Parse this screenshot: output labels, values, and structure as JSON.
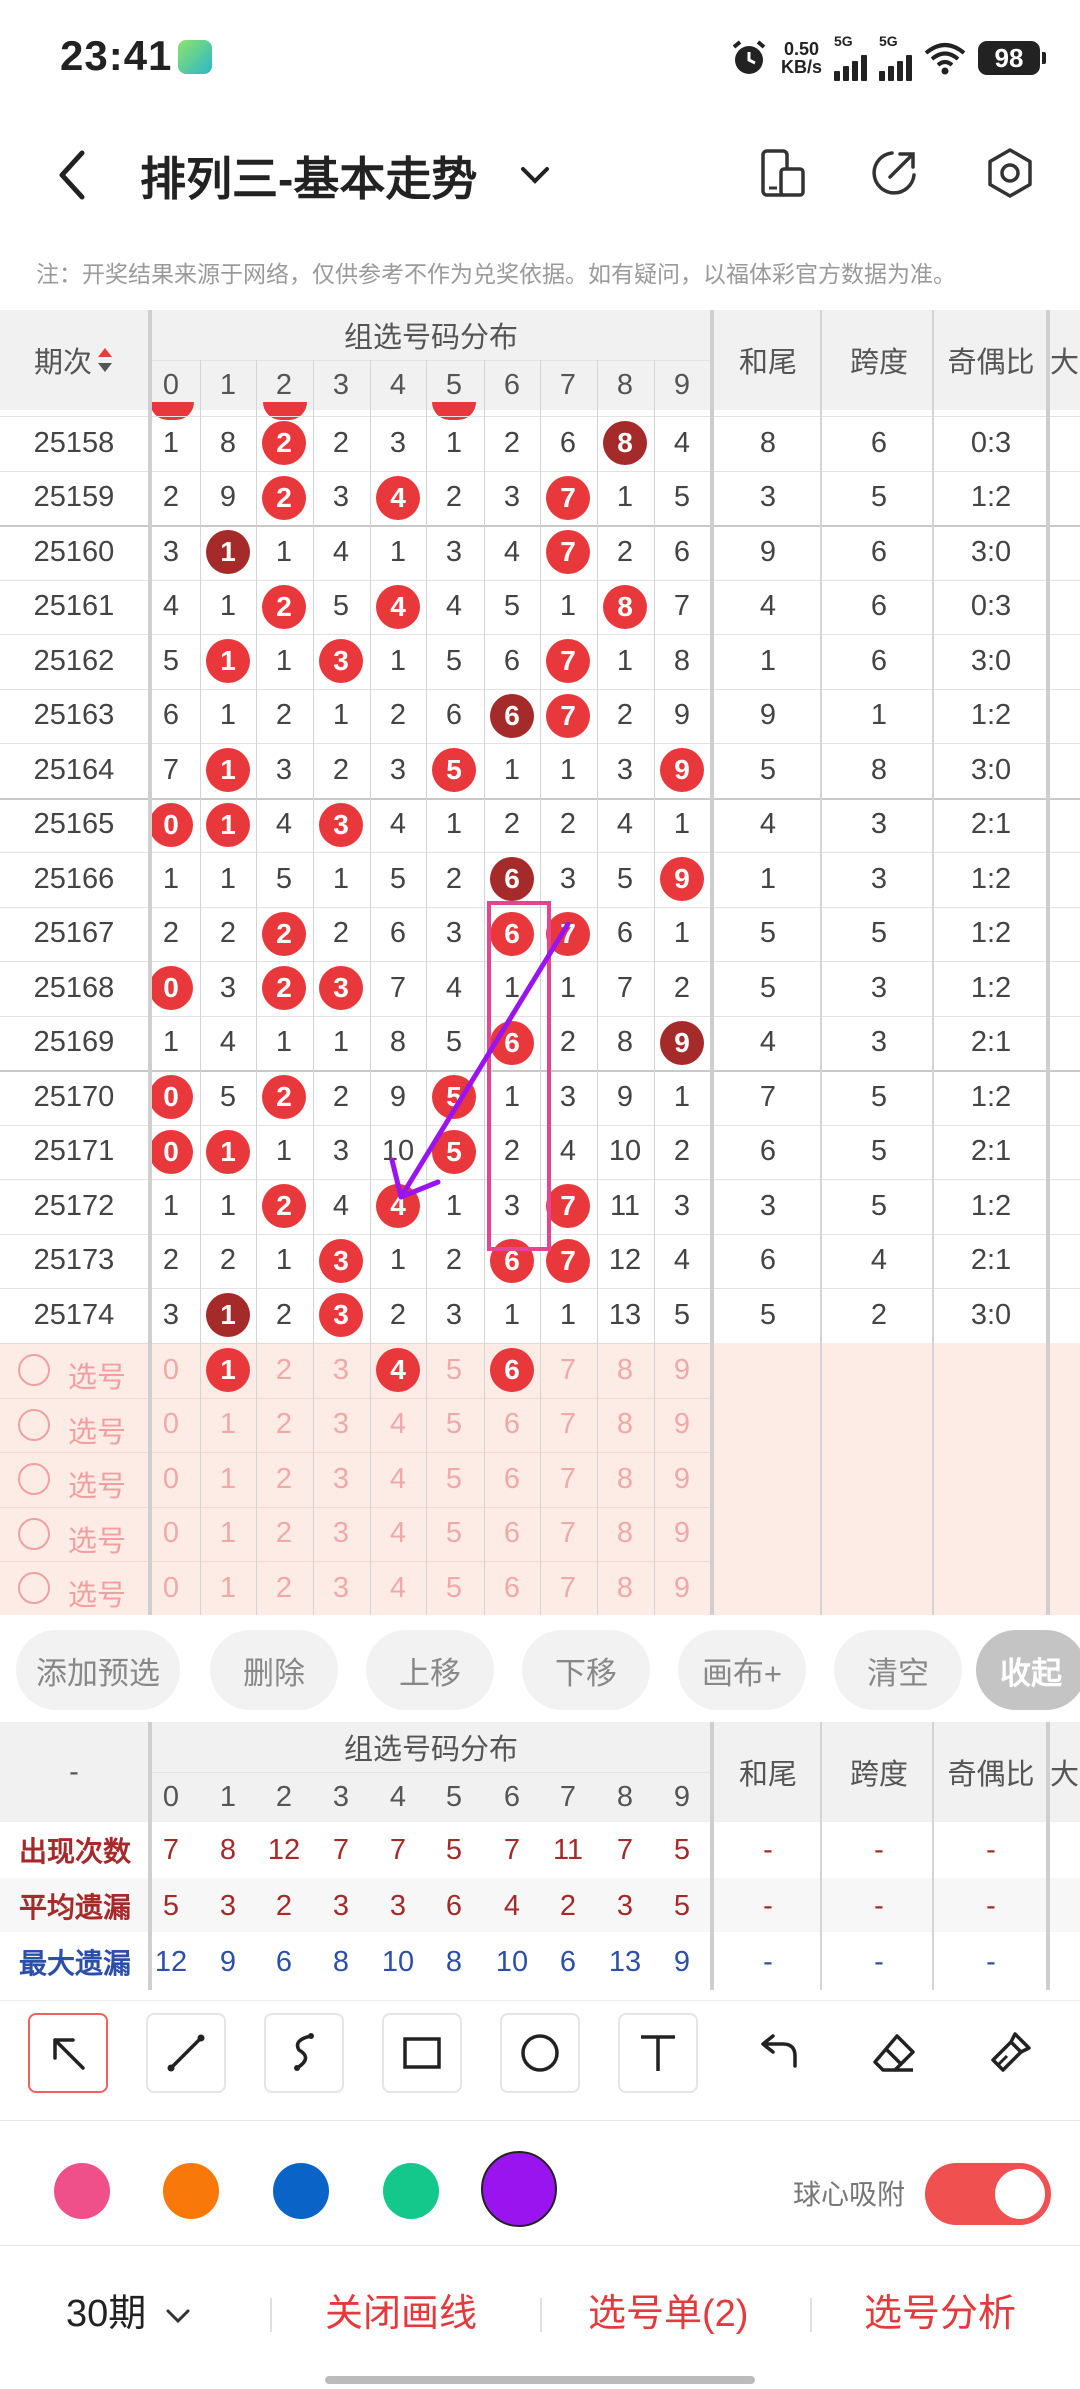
{
  "status_bar": {
    "time": "23:41",
    "net_speed_value": "0.50",
    "net_speed_unit": "KB/s",
    "signal1": "5G",
    "signal2": "5G",
    "battery": "98"
  },
  "header": {
    "title": "排列三-基本走势",
    "icons": [
      "back-icon",
      "chevron-down-icon",
      "phone-layout-icon",
      "share-icon",
      "settings-icon"
    ]
  },
  "notice": "注：开奖结果来源于网络，仅供参考不作为兑奖依据。如有疑问，以福体彩官方数据为准。",
  "table": {
    "col_period": "期次",
    "group_header": "组选号码分布",
    "digits": [
      "0",
      "1",
      "2",
      "3",
      "4",
      "5",
      "6",
      "7",
      "8",
      "9"
    ],
    "col_sum_tail": "和尾",
    "col_span": "跨度",
    "col_odd_even": "奇偶比",
    "col_big_small_partial": "大",
    "rows": [
      {
        "period": "25158",
        "cells": [
          "1",
          "8",
          "2",
          "2",
          "3",
          "1",
          "2",
          "6",
          "8",
          "4"
        ],
        "balls": {
          "2": "red",
          "8": "dark"
        },
        "sum_tail": "8",
        "span": "6",
        "odd_even": "0:3"
      },
      {
        "period": "25159",
        "cells": [
          "2",
          "9",
          "2",
          "3",
          "4",
          "2",
          "3",
          "7",
          "1",
          "5"
        ],
        "balls": {
          "2": "red",
          "4": "red",
          "7": "red"
        },
        "sum_tail": "3",
        "span": "5",
        "odd_even": "1:2"
      },
      {
        "period": "25160",
        "cells": [
          "3",
          "1",
          "1",
          "4",
          "1",
          "3",
          "4",
          "7",
          "2",
          "6"
        ],
        "balls": {
          "1": "dark",
          "7": "red"
        },
        "sum_tail": "9",
        "span": "6",
        "odd_even": "3:0"
      },
      {
        "period": "25161",
        "cells": [
          "4",
          "1",
          "2",
          "5",
          "4",
          "4",
          "5",
          "1",
          "8",
          "7"
        ],
        "balls": {
          "2": "red",
          "4": "red",
          "8": "red"
        },
        "sum_tail": "4",
        "span": "6",
        "odd_even": "0:3"
      },
      {
        "period": "25162",
        "cells": [
          "5",
          "1",
          "1",
          "3",
          "1",
          "5",
          "6",
          "7",
          "1",
          "8"
        ],
        "balls": {
          "1": "red",
          "3": "red",
          "7": "red"
        },
        "sum_tail": "1",
        "span": "6",
        "odd_even": "3:0"
      },
      {
        "period": "25163",
        "cells": [
          "6",
          "1",
          "2",
          "1",
          "2",
          "6",
          "6",
          "7",
          "2",
          "9"
        ],
        "balls": {
          "6": "dark",
          "7": "red"
        },
        "sum_tail": "9",
        "span": "1",
        "odd_even": "1:2"
      },
      {
        "period": "25164",
        "cells": [
          "7",
          "1",
          "3",
          "2",
          "3",
          "5",
          "1",
          "1",
          "3",
          "9"
        ],
        "balls": {
          "1": "red",
          "5": "red",
          "9": "red"
        },
        "sum_tail": "5",
        "span": "8",
        "odd_even": "3:0"
      },
      {
        "period": "25165",
        "cells": [
          "0",
          "1",
          "4",
          "3",
          "4",
          "1",
          "2",
          "2",
          "4",
          "1"
        ],
        "balls": {
          "0": "red",
          "1": "red",
          "3": "red"
        },
        "sum_tail": "4",
        "span": "3",
        "odd_even": "2:1"
      },
      {
        "period": "25166",
        "cells": [
          "1",
          "1",
          "5",
          "1",
          "5",
          "2",
          "6",
          "3",
          "5",
          "9"
        ],
        "balls": {
          "6": "dark",
          "9": "red"
        },
        "sum_tail": "1",
        "span": "3",
        "odd_even": "1:2"
      },
      {
        "period": "25167",
        "cells": [
          "2",
          "2",
          "2",
          "2",
          "6",
          "3",
          "6",
          "7",
          "6",
          "1"
        ],
        "balls": {
          "2": "red",
          "6": "red",
          "7": "red"
        },
        "sum_tail": "5",
        "span": "5",
        "odd_even": "1:2"
      },
      {
        "period": "25168",
        "cells": [
          "0",
          "3",
          "2",
          "3",
          "7",
          "4",
          "1",
          "1",
          "7",
          "2"
        ],
        "balls": {
          "0": "red",
          "2": "red",
          "3": "red"
        },
        "sum_tail": "5",
        "span": "3",
        "odd_even": "1:2"
      },
      {
        "period": "25169",
        "cells": [
          "1",
          "4",
          "1",
          "1",
          "8",
          "5",
          "6",
          "2",
          "8",
          "9"
        ],
        "balls": {
          "6": "red",
          "9": "dark"
        },
        "sum_tail": "4",
        "span": "3",
        "odd_even": "2:1"
      },
      {
        "period": "25170",
        "cells": [
          "0",
          "5",
          "2",
          "2",
          "9",
          "5",
          "1",
          "3",
          "9",
          "1"
        ],
        "balls": {
          "0": "red",
          "2": "red",
          "5": "red"
        },
        "sum_tail": "7",
        "span": "5",
        "odd_even": "1:2"
      },
      {
        "period": "25171",
        "cells": [
          "0",
          "1",
          "1",
          "3",
          "10",
          "5",
          "2",
          "4",
          "10",
          "2"
        ],
        "balls": {
          "0": "red",
          "1": "red",
          "5": "red"
        },
        "sum_tail": "6",
        "span": "5",
        "odd_even": "2:1"
      },
      {
        "period": "25172",
        "cells": [
          "1",
          "1",
          "2",
          "4",
          "4",
          "1",
          "3",
          "7",
          "11",
          "3"
        ],
        "balls": {
          "2": "red",
          "4": "red",
          "7": "red"
        },
        "sum_tail": "3",
        "span": "5",
        "odd_even": "1:2"
      },
      {
        "period": "25173",
        "cells": [
          "2",
          "2",
          "1",
          "3",
          "1",
          "2",
          "6",
          "7",
          "12",
          "4"
        ],
        "balls": {
          "3": "red",
          "6": "red",
          "7": "red"
        },
        "sum_tail": "6",
        "span": "4",
        "odd_even": "2:1"
      },
      {
        "period": "25174",
        "cells": [
          "3",
          "1",
          "2",
          "3",
          "2",
          "3",
          "1",
          "1",
          "13",
          "5"
        ],
        "balls": {
          "1": "dark",
          "3": "red"
        },
        "sum_tail": "5",
        "span": "2",
        "odd_even": "3:0"
      }
    ],
    "pick_rows": [
      {
        "label": "选号",
        "selected": {
          "1": true,
          "4": true,
          "6": true
        }
      },
      {
        "label": "选号",
        "selected": {}
      },
      {
        "label": "选号",
        "selected": {}
      },
      {
        "label": "选号",
        "selected": {}
      },
      {
        "label": "选号",
        "selected": {}
      }
    ]
  },
  "actions": [
    "添加预选",
    "删除",
    "上移",
    "下移",
    "画布+",
    "清空",
    "收起"
  ],
  "stats": {
    "corner": "-",
    "group_header": "组选号码分布",
    "digits": [
      "0",
      "1",
      "2",
      "3",
      "4",
      "5",
      "6",
      "7",
      "8",
      "9"
    ],
    "col_sum_tail": "和尾",
    "col_span": "跨度",
    "col_odd_even": "奇偶比",
    "col_big_small_partial": "大",
    "rows": [
      {
        "label": "出现次数",
        "values": [
          "7",
          "8",
          "12",
          "7",
          "7",
          "5",
          "7",
          "11",
          "7",
          "5"
        ],
        "extra": [
          "-",
          "-",
          "-"
        ],
        "color": "#a52a2a"
      },
      {
        "label": "平均遗漏",
        "values": [
          "5",
          "3",
          "2",
          "3",
          "3",
          "6",
          "4",
          "2",
          "3",
          "5"
        ],
        "extra": [
          "-",
          "-",
          "-"
        ],
        "color": "#a52a2a"
      },
      {
        "label": "最大遗漏",
        "values": [
          "12",
          "9",
          "6",
          "8",
          "10",
          "8",
          "10",
          "6",
          "13",
          "9"
        ],
        "extra": [
          "-",
          "-",
          "-"
        ],
        "color": "#2d4fa8"
      }
    ]
  },
  "tools": [
    "select-arrow-icon",
    "line-icon",
    "curve-icon",
    "rectangle-icon",
    "circle-icon",
    "text-icon",
    "undo-icon",
    "eraser-icon",
    "clear-brush-icon"
  ],
  "colors": [
    "#f0508a",
    "#f8780a",
    "#0a64c8",
    "#14c88c",
    "#9a14f0"
  ],
  "selected_color": "#9a14f0",
  "snap_label": "球心吸附",
  "snap_enabled": true,
  "bottom_bar": {
    "period_count": "30期",
    "close_draw": "关闭画线",
    "pick_list": "选号单(2)",
    "pick_analysis": "选号分析"
  }
}
